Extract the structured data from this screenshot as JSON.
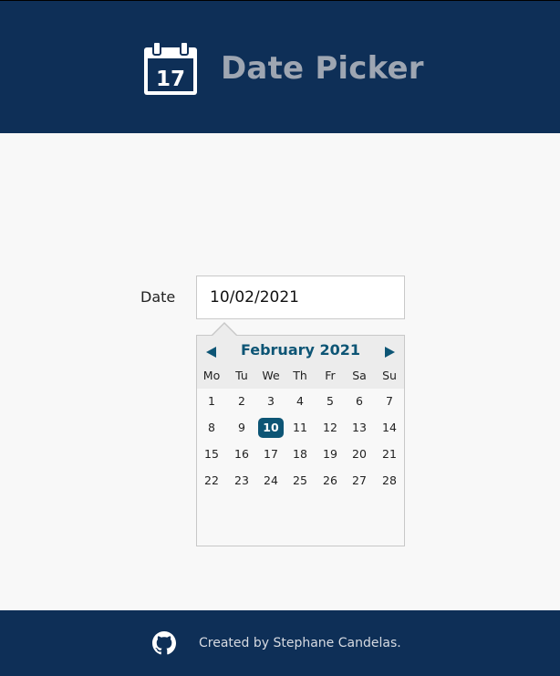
{
  "header": {
    "title": "Date Picker",
    "logo_icon": "calendar-icon",
    "logo_day": "17",
    "background": "#0e2f57"
  },
  "form": {
    "date_label": "Date",
    "date_value": "10/02/2021"
  },
  "calendar": {
    "month_title": "February 2021",
    "prev_icon": "triangle-left-icon",
    "next_icon": "triangle-right-icon",
    "weekdays": [
      "Mo",
      "Tu",
      "We",
      "Th",
      "Fr",
      "Sa",
      "Su"
    ],
    "weeks": [
      [
        "1",
        "2",
        "3",
        "4",
        "5",
        "6",
        "7"
      ],
      [
        "8",
        "9",
        "10",
        "11",
        "12",
        "13",
        "14"
      ],
      [
        "15",
        "16",
        "17",
        "18",
        "19",
        "20",
        "21"
      ],
      [
        "22",
        "23",
        "24",
        "25",
        "26",
        "27",
        "28"
      ]
    ],
    "selected_day": "10",
    "accent": "#0d5575"
  },
  "footer": {
    "icon": "github-icon",
    "text": "Created by Stephane Candelas."
  }
}
